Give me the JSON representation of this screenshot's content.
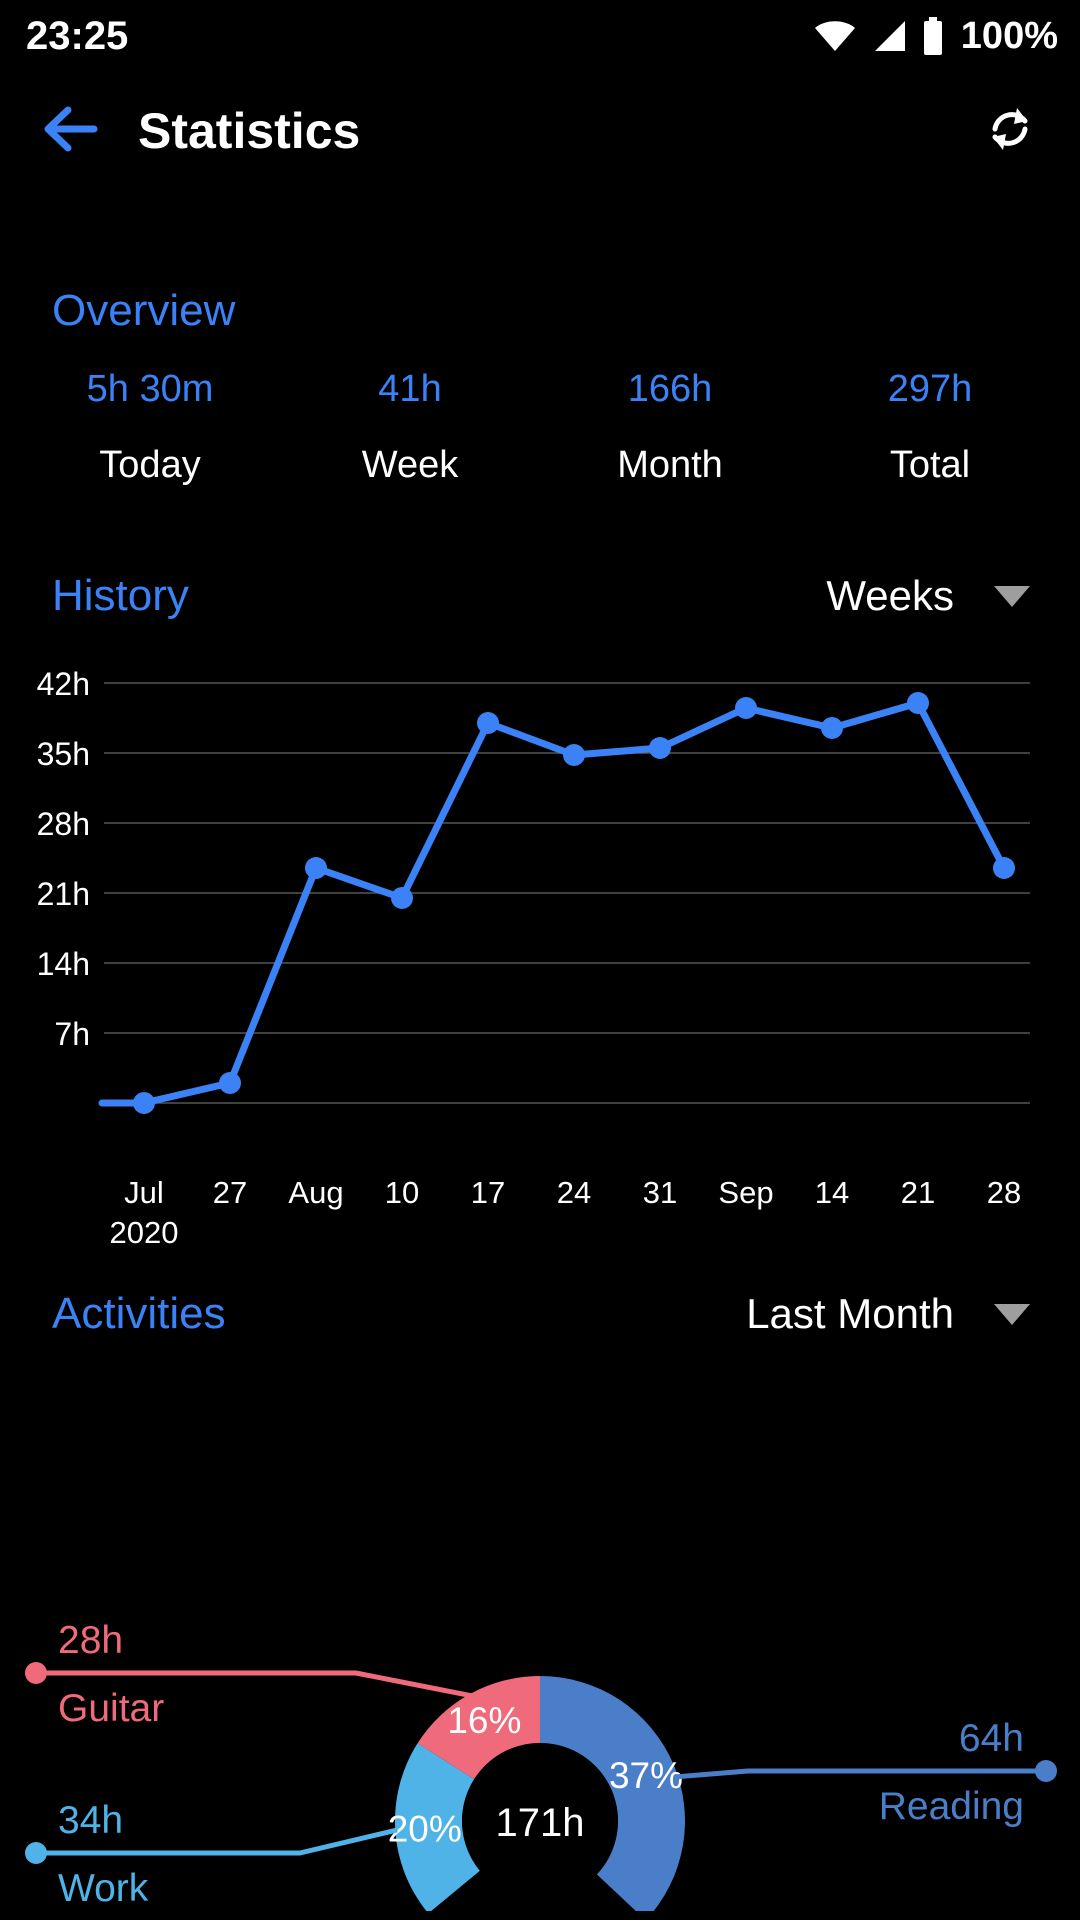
{
  "status_bar": {
    "time": "23:25",
    "battery_percent": "100%",
    "icons": [
      "wifi-icon",
      "cellular-signal-icon",
      "battery-icon"
    ]
  },
  "app_bar": {
    "back_icon": "arrow-left-icon",
    "title": "Statistics",
    "refresh_icon": "refresh-sync-icon",
    "accent_color": "#3b82f6"
  },
  "overview": {
    "title": "Overview",
    "stats": [
      {
        "value": "5h 30m",
        "label": "Today"
      },
      {
        "value": "41h",
        "label": "Week"
      },
      {
        "value": "166h",
        "label": "Month"
      },
      {
        "value": "297h",
        "label": "Total"
      }
    ]
  },
  "history": {
    "title": "History",
    "dropdown_value": "Weeks",
    "dropdown_icon": "chevron-down-icon"
  },
  "activities": {
    "title": "Activities",
    "dropdown_value": "Last Month",
    "dropdown_icon": "chevron-down-icon"
  },
  "chart_data": [
    {
      "type": "line",
      "title": "History",
      "xlabel": "",
      "ylabel": "",
      "grid": true,
      "legend": "none",
      "line_color": "#3b82f6",
      "ylim": [
        0,
        42
      ],
      "yticks": [
        42,
        35,
        28,
        21,
        14,
        7
      ],
      "ytick_labels": [
        "42h",
        "35h",
        "28h",
        "21h",
        "14h",
        "7h"
      ],
      "categories": [
        "Jul\n2020",
        "27",
        "Aug",
        "10",
        "17",
        "24",
        "31",
        "Sep",
        "14",
        "21",
        "28"
      ],
      "x": [
        "Jul 2020",
        "27",
        "Aug",
        "10",
        "17",
        "24",
        "31",
        "Sep",
        "14",
        "21",
        "28"
      ],
      "values": [
        0,
        2,
        23.5,
        20.5,
        38,
        34.8,
        35.5,
        39.5,
        37.5,
        40,
        23.5
      ]
    },
    {
      "type": "pie",
      "title": "Activities",
      "subtitle": "Last Month",
      "center_label": "171h",
      "donut": true,
      "legend": "callout-labels",
      "categories": [
        "Guitar",
        "Work",
        "Reading"
      ],
      "values": [
        28,
        34,
        64
      ],
      "percent_labels": [
        "16%",
        "20%",
        "37%"
      ],
      "value_labels": [
        "28h",
        "34h",
        "64h"
      ],
      "colors": [
        "#ef6b7b",
        "#4fb3e8",
        "#4a7ec9"
      ],
      "slices": [
        {
          "name": "Guitar",
          "hours": "28h",
          "percent": "16%",
          "color": "#ef6b7b",
          "label_side": "left"
        },
        {
          "name": "Work",
          "hours": "34h",
          "percent": "20%",
          "color": "#4fb3e8",
          "label_side": "left"
        },
        {
          "name": "Reading",
          "hours": "64h",
          "percent": "37%",
          "color": "#4a7ec9",
          "label_side": "right"
        }
      ]
    }
  ]
}
